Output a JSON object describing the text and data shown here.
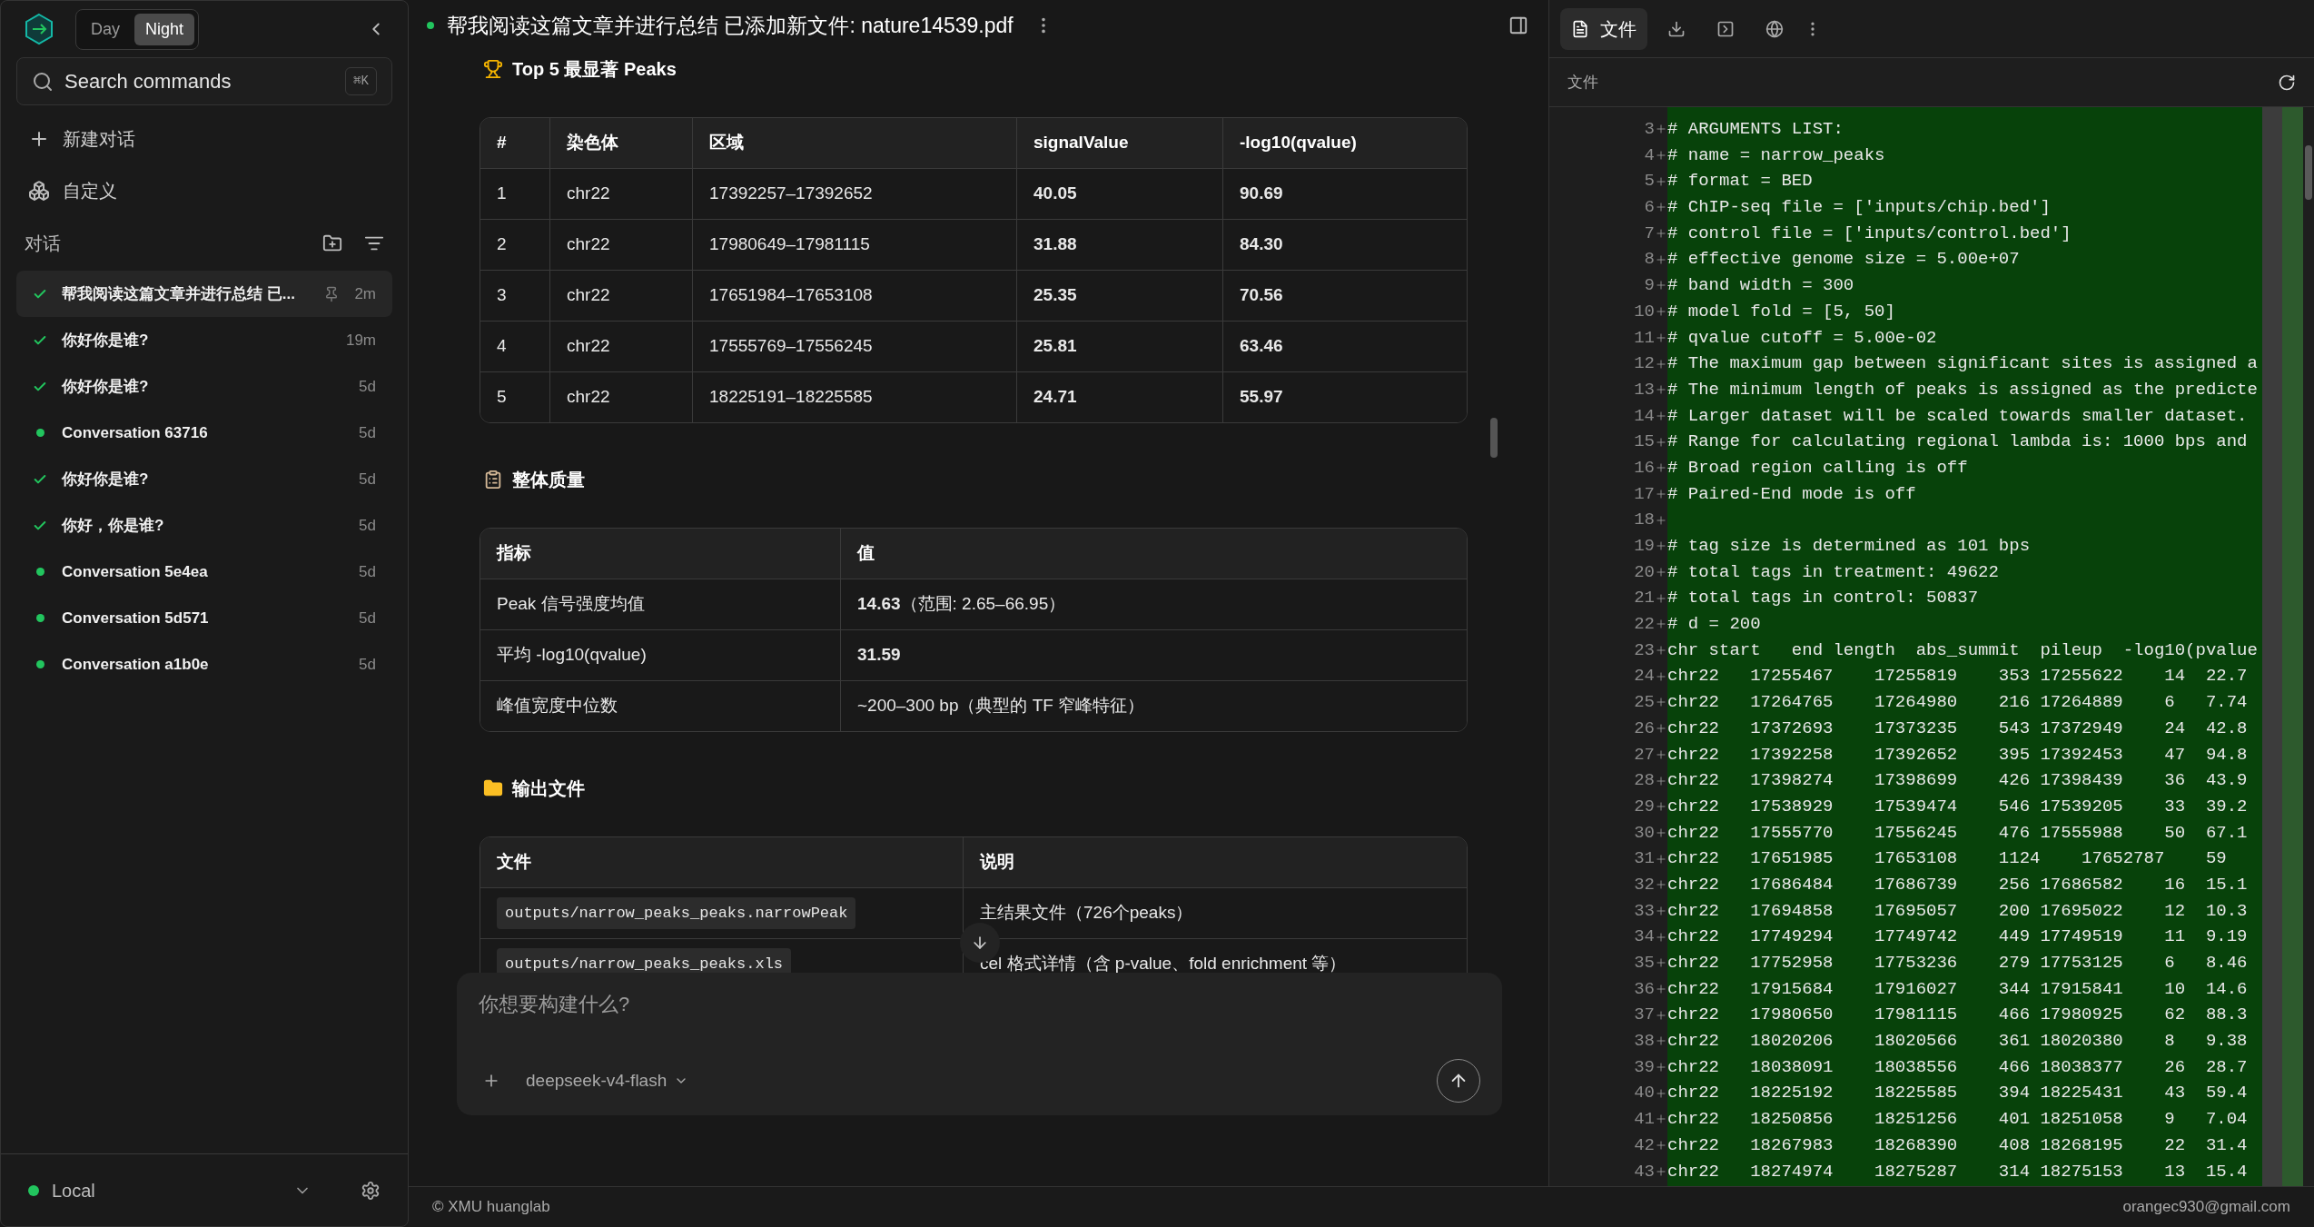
{
  "sidebar": {
    "theme_toggle": [
      {
        "label": "Day",
        "selected": false
      },
      {
        "label": "Night",
        "selected": true
      }
    ],
    "search": {
      "placeholder": "Search commands",
      "shortcut": "⌘K"
    },
    "actions": [
      {
        "label": "新建对话",
        "kind": "new"
      },
      {
        "label": "自定义",
        "kind": "customize"
      }
    ],
    "section_title": "对话",
    "conversations": [
      {
        "title": "帮我阅读这篇文章并进行总结 已...",
        "time": "2m",
        "completed": true,
        "selected": true
      },
      {
        "title": "你好你是谁?",
        "time": "19m",
        "completed": true,
        "selected": false
      },
      {
        "title": "你好你是谁?",
        "time": "5d",
        "completed": true,
        "selected": false
      },
      {
        "title": "Conversation 63716",
        "time": "5d",
        "completed": false,
        "selected": false
      },
      {
        "title": "你好你是谁?",
        "time": "5d",
        "completed": true,
        "selected": false
      },
      {
        "title": "你好，你是谁?",
        "time": "5d",
        "completed": true,
        "selected": false
      },
      {
        "title": "Conversation 5e4ea",
        "time": "5d",
        "completed": false,
        "selected": false
      },
      {
        "title": "Conversation 5d571",
        "time": "5d",
        "completed": false,
        "selected": false
      },
      {
        "title": "Conversation a1b0e",
        "time": "5d",
        "completed": false,
        "selected": false
      }
    ],
    "connection": {
      "label": "Local",
      "online": true
    }
  },
  "chat": {
    "title": "帮我阅读这篇文章并进行总结 已添加新文件: nature14539.pdf",
    "online": true,
    "sections": [
      {
        "title": "Top 5 最显著 Peaks",
        "table": {
          "columns": [
            {
              "label": "#",
              "kind": "plain"
            },
            {
              "label": "染色体",
              "kind": "plain"
            },
            {
              "label": "区域",
              "kind": "plain"
            },
            {
              "label": "signalValue",
              "kind": "bold"
            },
            {
              "label": "-log10(qvalue)",
              "kind": "bold"
            }
          ],
          "rows": [
            [
              "1",
              "chr22",
              "17392257–17392652",
              "40.05",
              "90.69"
            ],
            [
              "2",
              "chr22",
              "17980649–17981115",
              "31.88",
              "84.30"
            ],
            [
              "3",
              "chr22",
              "17651984–17653108",
              "25.35",
              "70.56"
            ],
            [
              "4",
              "chr22",
              "17555769–17556245",
              "25.81",
              "63.46"
            ],
            [
              "5",
              "chr22",
              "18225191–18225585",
              "24.71",
              "55.97"
            ]
          ]
        }
      },
      {
        "title": "整体质量",
        "table": {
          "columns": [
            {
              "label": "指标",
              "kind": "plain"
            },
            {
              "label": "值",
              "kind": "plain"
            }
          ],
          "rows": [
            [
              "Peak 信号强度均值",
              "**14.63**（范围: 2.65–66.95）"
            ],
            [
              "平均 -log10(qvalue)",
              {
                "text": "31.59",
                "bold": true
              }
            ],
            [
              "峰值宽度中位数",
              "~200–300 bp（典型的 TF 窄峰特征）"
            ]
          ]
        }
      },
      {
        "title": "输出文件",
        "table": {
          "columns": [
            {
              "label": "文件",
              "kind": "code"
            },
            {
              "label": "说明",
              "kind": "plain"
            }
          ],
          "rows": [
            [
              "outputs/narrow_peaks_peaks.narrowPeak",
              "主结果文件（726个peaks）"
            ],
            [
              "outputs/narrow_peaks_peaks.xls",
              "cel 格式详情（含 p-value、fold enrichment 等）"
            ]
          ]
        }
      }
    ],
    "input": {
      "placeholder": "你想要构建什么?",
      "model": "deepseek-v4-flash"
    }
  },
  "files_panel": {
    "tabs": [
      {
        "label": "文件",
        "kind": "file",
        "selected": true
      },
      {
        "kind": "download",
        "selected": false
      },
      {
        "kind": "terminal",
        "selected": false
      },
      {
        "kind": "globe",
        "selected": false
      }
    ],
    "breadcrumb": "文件",
    "lines": [
      {
        "number": "3",
        "text": "# ARGUMENTS LIST:"
      },
      {
        "number": "4",
        "text": "# name = narrow_peaks"
      },
      {
        "number": "5",
        "text": "# format = BED"
      },
      {
        "number": "6",
        "text": "# ChIP-seq file = ['inputs/chip.bed']"
      },
      {
        "number": "7",
        "text": "# control file = ['inputs/control.bed']"
      },
      {
        "number": "8",
        "text": "# effective genome size = 5.00e+07"
      },
      {
        "number": "9",
        "text": "# band width = 300"
      },
      {
        "number": "10",
        "text": "# model fold = [5, 50]"
      },
      {
        "number": "11",
        "text": "# qvalue cutoff = 5.00e-02"
      },
      {
        "number": "12",
        "text": "# The maximum gap between significant sites is assigned a"
      },
      {
        "number": "13",
        "text": "# The minimum length of peaks is assigned as the predicte"
      },
      {
        "number": "14",
        "text": "# Larger dataset will be scaled towards smaller dataset."
      },
      {
        "number": "15",
        "text": "# Range for calculating regional lambda is: 1000 bps and"
      },
      {
        "number": "16",
        "text": "# Broad region calling is off"
      },
      {
        "number": "17",
        "text": "# Paired-End mode is off"
      },
      {
        "number": "18"
      },
      {
        "number": "19",
        "text": "# tag size is determined as 101 bps"
      },
      {
        "number": "20",
        "text": "# total tags in treatment: 49622"
      },
      {
        "number": "21",
        "text": "# total tags in control: 50837"
      },
      {
        "number": "22",
        "text": "# d = 200"
      },
      {
        "number": "23",
        "text": "chr start   end length  abs_summit  pileup  -log10(pvalue"
      },
      {
        "number": "24",
        "text": "chr22   17255467    17255819    353 17255622    14  22.7"
      },
      {
        "number": "25",
        "text": "chr22   17264765    17264980    216 17264889    6   7.74"
      },
      {
        "number": "26",
        "text": "chr22   17372693    17373235    543 17372949    24  42.8"
      },
      {
        "number": "27",
        "text": "chr22   17392258    17392652    395 17392453    47  94.8"
      },
      {
        "number": "28",
        "text": "chr22   17398274    17398699    426 17398439    36  43.9"
      },
      {
        "number": "29",
        "text": "chr22   17538929    17539474    546 17539205    33  39.2"
      },
      {
        "number": "30",
        "text": "chr22   17555770    17556245    476 17555988    50  67.1"
      },
      {
        "number": "31",
        "text": "chr22   17651985    17653108    1124    17652787    59"
      },
      {
        "number": "32",
        "text": "chr22   17686484    17686739    256 17686582    16  15.1"
      },
      {
        "number": "33",
        "text": "chr22   17694858    17695057    200 17695022    12  10.3"
      },
      {
        "number": "34",
        "text": "chr22   17749294    17749742    449 17749519    11  9.19"
      },
      {
        "number": "35",
        "text": "chr22   17752958    17753236    279 17753125    6   8.46"
      },
      {
        "number": "36",
        "text": "chr22   17915684    17916027    344 17915841    10  14.6"
      },
      {
        "number": "37",
        "text": "chr22   17980650    17981115    466 17980925    62  88.3"
      },
      {
        "number": "38",
        "text": "chr22   18020206    18020566    361 18020380    8   9.38"
      },
      {
        "number": "39",
        "text": "chr22   18038091    18038556    466 18038377    26  28.7"
      },
      {
        "number": "40",
        "text": "chr22   18225192    18225585    394 18225431    43  59.4"
      },
      {
        "number": "41",
        "text": "chr22   18250856    18251256    401 18251058    9   7.04"
      },
      {
        "number": "42",
        "text": "chr22   18267983    18268390    408 18268195    22  31.4"
      },
      {
        "number": "43",
        "text": "chr22   18274974    18275287    314 18275153    13  15.4"
      }
    ]
  },
  "status_bar": {
    "left": "© XMU huanglab",
    "right": "orangec930@gmail.com"
  }
}
